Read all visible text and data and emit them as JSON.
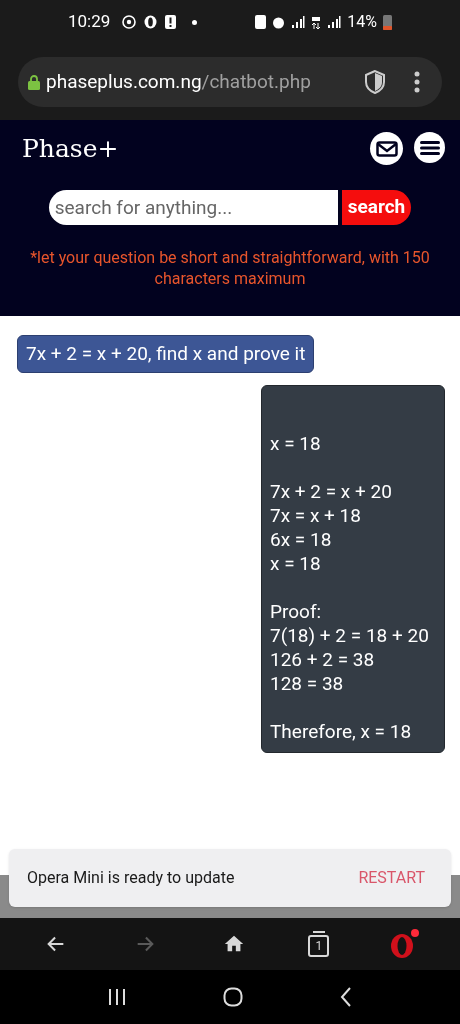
{
  "status_bar": {
    "time": "10:29",
    "battery": "14%"
  },
  "address_bar": {
    "domain": "phaseplus.com.ng",
    "path": "/chatbot.php",
    "secure": true
  },
  "header": {
    "logo": "Phase+"
  },
  "search": {
    "placeholder": "search for anything...",
    "button": "search"
  },
  "notice": "*let your question be short and straightforward, with 150 characters maximum",
  "messages": [
    {
      "kind": "question",
      "text": "7x + 2 = x + 20, find x and prove it"
    },
    {
      "kind": "answer",
      "paragraphs": [
        [
          "x = 18"
        ],
        [
          "7x + 2 = x + 20",
          "7x = x + 18",
          "6x = 18",
          "x = 18"
        ],
        [
          "Proof:",
          "7(18) + 2 = 18 + 20",
          "126 + 2 = 38",
          "128 = 38"
        ],
        [
          "Therefore, x = 18"
        ]
      ]
    }
  ],
  "toast": {
    "text": "Opera Mini is ready to update",
    "action": "RESTART"
  },
  "bottom_nav": [
    {
      "kind": "back",
      "disabled": false
    },
    {
      "kind": "forward",
      "disabled": true
    },
    {
      "kind": "home",
      "disabled": false
    },
    {
      "kind": "tabs",
      "disabled": false,
      "count": "1"
    },
    {
      "kind": "opera",
      "disabled": false,
      "badge": true
    }
  ]
}
